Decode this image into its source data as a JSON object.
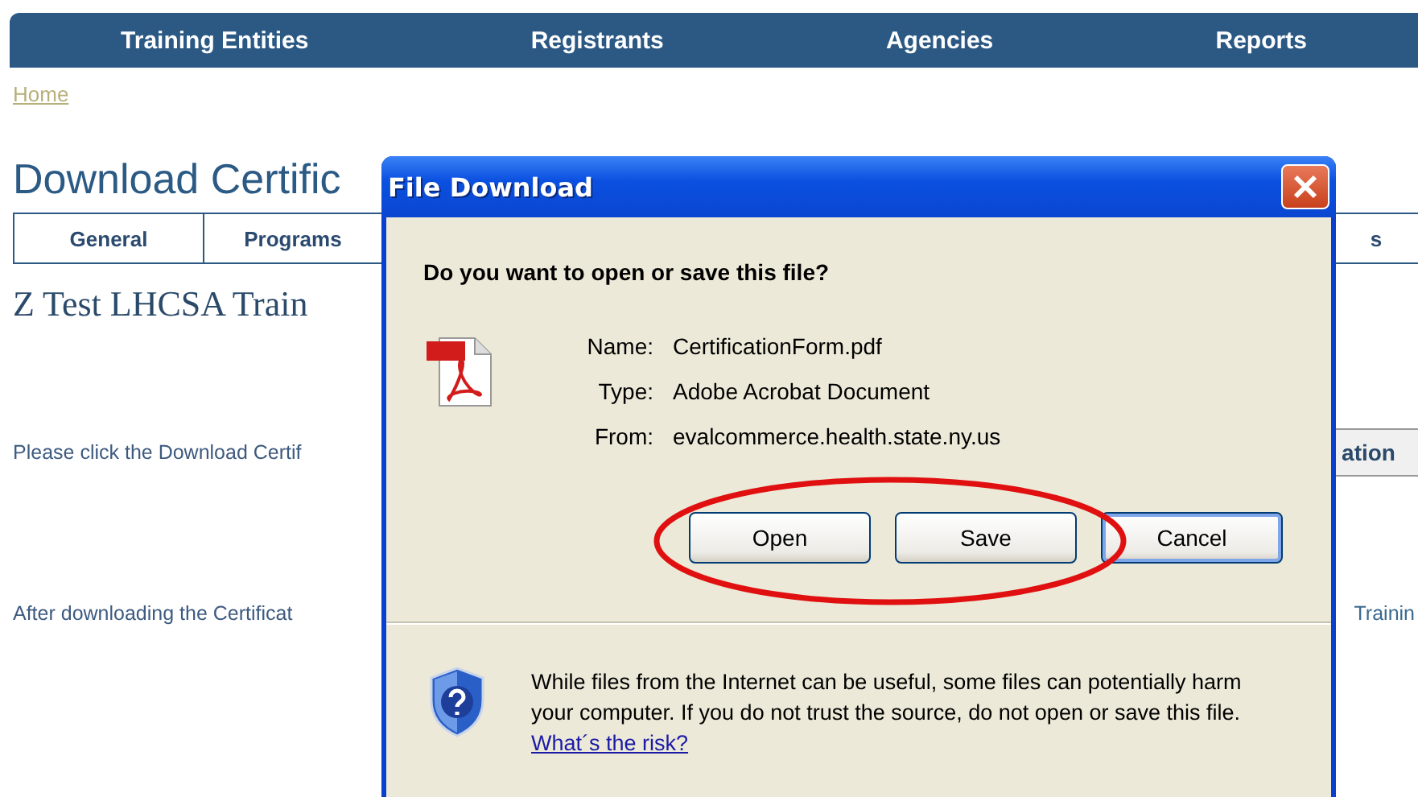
{
  "nav": {
    "items": [
      "Training Entities",
      "Registrants",
      "Agencies",
      "Reports"
    ]
  },
  "breadcrumb": "Home",
  "page_title": "Download Certific",
  "tabs": [
    {
      "label": "General"
    },
    {
      "label": "Programs"
    },
    {
      "label": "s"
    }
  ],
  "entity_name": "Z Test LHCSA Train",
  "instruction_1": {
    "text": "Please click the Download Certif",
    "button": "ation"
  },
  "instruction_2": {
    "text": "After downloading the Certificat",
    "trailing": "Trainin"
  },
  "dialog": {
    "title": "File Download",
    "question": "Do you want to open or save this file?",
    "fields": [
      {
        "label": "Name:",
        "value": "CertificationForm.pdf"
      },
      {
        "label": "Type:",
        "value": "Adobe Acrobat Document"
      },
      {
        "label": "From:",
        "value": "evalcommerce.health.state.ny.us"
      }
    ],
    "buttons": [
      {
        "label": "Open",
        "focused": false
      },
      {
        "label": "Save",
        "focused": false
      },
      {
        "label": "Cancel",
        "focused": true
      }
    ],
    "warning": "While files from the Internet can be useful, some files can potentially harm your computer. If you do not trust the source, do not open or save this file.",
    "warning_link": "What´s the risk?"
  },
  "annotation": {
    "kind": "ellipse"
  }
}
